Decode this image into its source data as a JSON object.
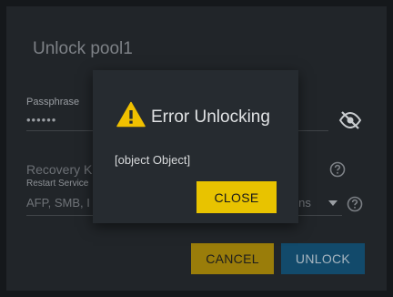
{
  "unlock_dialog": {
    "title": "Unlock pool1",
    "passphrase": {
      "label": "Passphrase",
      "value": "••••••"
    },
    "recovery_key": {
      "label": "Recovery K"
    },
    "restart_services": {
      "label": "Restart Service",
      "value": "AFP, SMB, I",
      "value_suffix": "gins"
    },
    "cancel_label": "CANCEL",
    "unlock_label": "UNLOCK"
  },
  "error_dialog": {
    "title": "Error Unlocking",
    "message": "[object Object]",
    "close_label": "CLOSE"
  },
  "icons": {
    "warning": "warning-icon",
    "visibility_off": "eye-off-icon",
    "help": "help-icon",
    "dropdown": "dropdown-arrow-icon"
  },
  "colors": {
    "warning": "#f0c000",
    "primary_button": "#e8c300",
    "secondary_button": "#124a6b"
  }
}
